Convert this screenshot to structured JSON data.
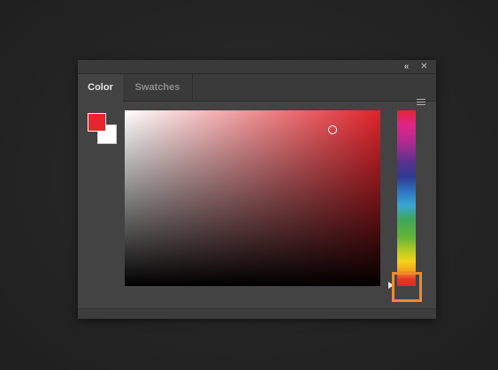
{
  "panel": {
    "collapse_glyph": "«",
    "close_glyph": "✕",
    "menu_icon": "hamburger-menu-icon"
  },
  "tabs": [
    {
      "label": "Color",
      "active": true
    },
    {
      "label": "Swatches",
      "active": false
    }
  ],
  "colors": {
    "foreground": "#e4262d",
    "background": "#ffffff",
    "hue_base": "#e0232a",
    "highlight": "#ef8a2c"
  }
}
